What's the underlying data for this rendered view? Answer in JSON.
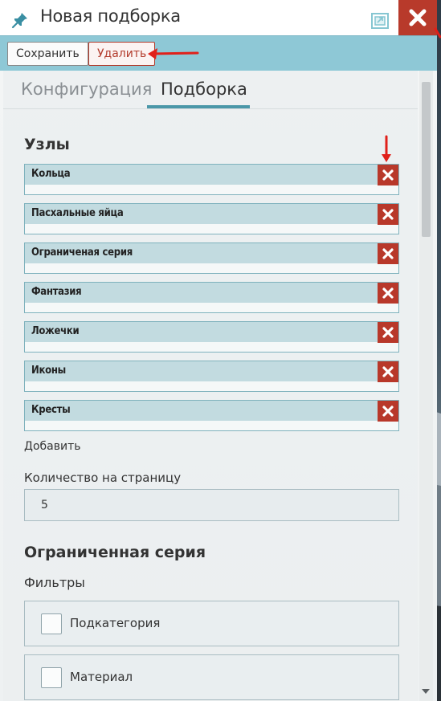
{
  "window": {
    "title": "Новая подборка"
  },
  "toolbar": {
    "save_label": "Сохранить",
    "delete_label": "Удалить"
  },
  "tabs": [
    {
      "label": "Конфигурация"
    },
    {
      "label": "Подборка"
    }
  ],
  "nodes": {
    "heading": "Узлы",
    "items": [
      "Кольца",
      "Пасхальные яйца",
      "Ограниченая серия",
      "Фантазия",
      "Ложечки",
      "Иконы",
      "Кресты"
    ],
    "add_label": "Добавить"
  },
  "per_page": {
    "label": "Количество на страницу",
    "value": "5"
  },
  "section": {
    "heading": "Ограниченная серия",
    "filters_label": "Фильтры",
    "filters": [
      "Подкатегория",
      "Материал"
    ]
  },
  "colors": {
    "accent": "#8ec8d6",
    "danger": "#b83a2b",
    "tab_active": "#4a97a8"
  }
}
